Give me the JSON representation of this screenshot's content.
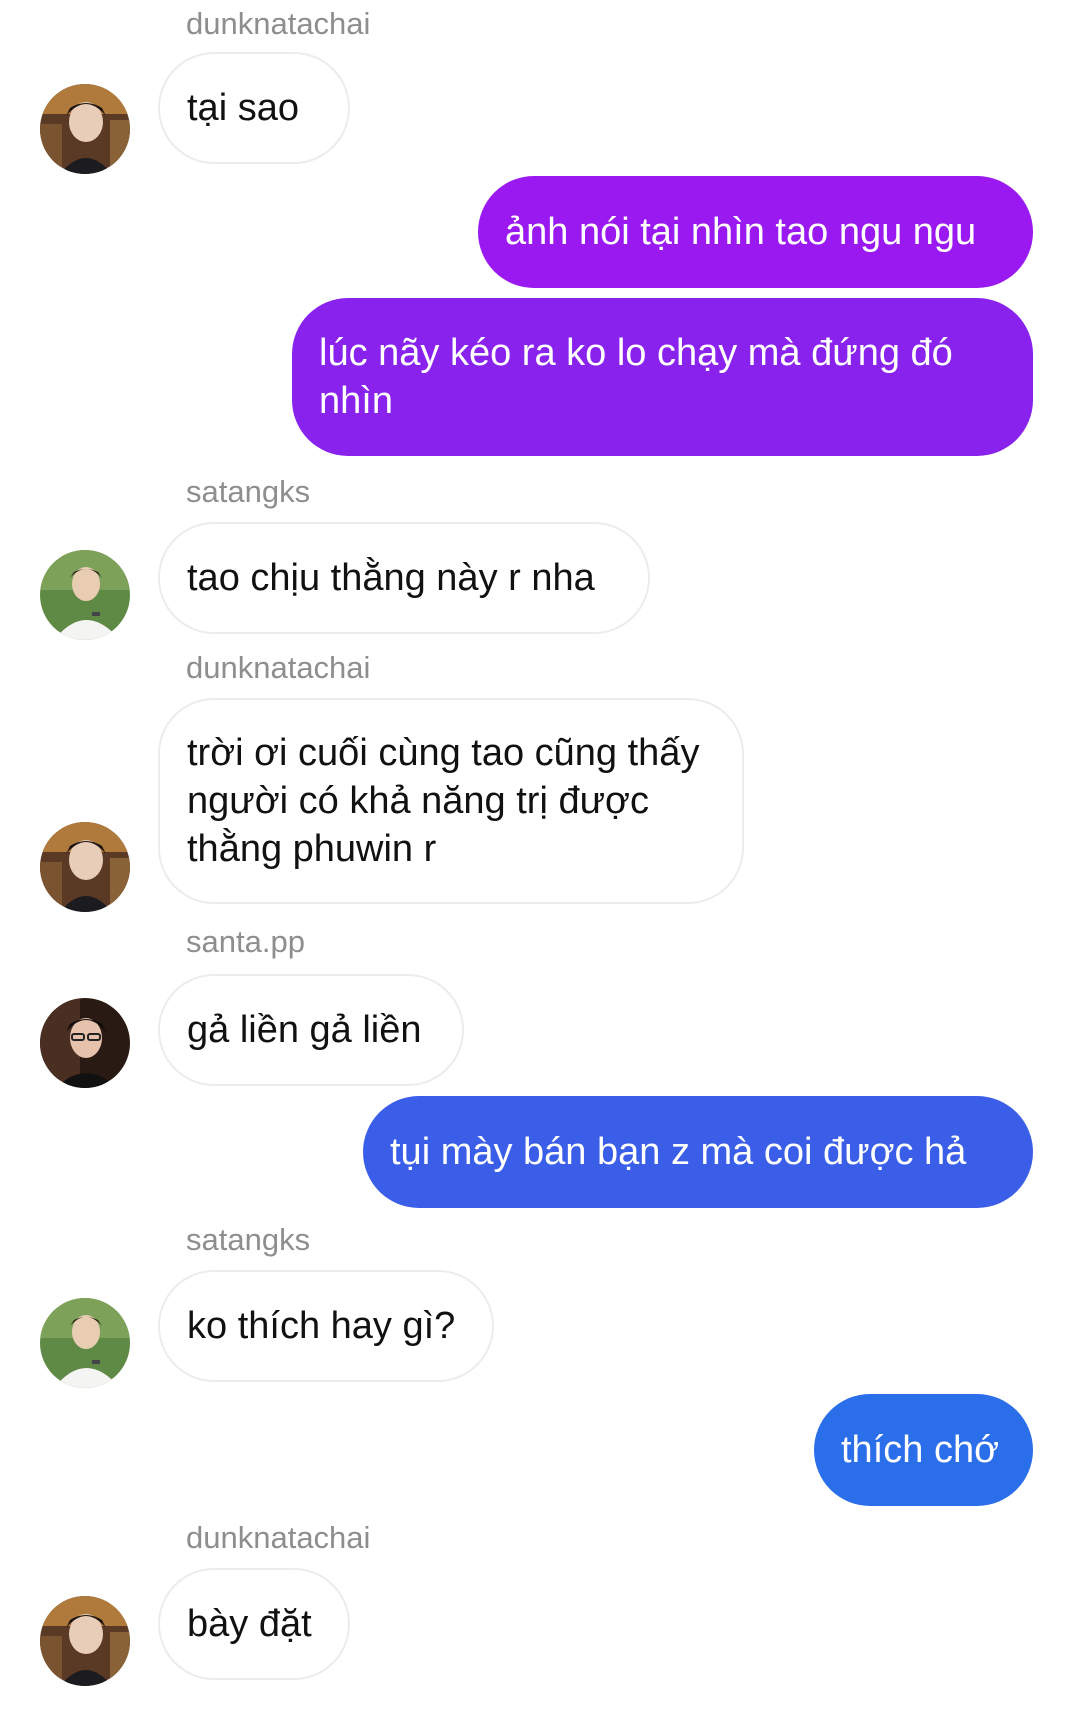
{
  "messages": [
    {
      "id": "m1",
      "direction": "in",
      "sender": "dunknatachai",
      "text": "tại sao",
      "avatar": "dunk-avatar"
    },
    {
      "id": "m2",
      "direction": "out",
      "text": "ảnh nói tại nhìn tao ngu ngu",
      "color": "#9a19f0"
    },
    {
      "id": "m3",
      "direction": "out",
      "text": "lúc nãy kéo ra ko lo chạy mà đứng đó nhìn",
      "color": "#8a22ee"
    },
    {
      "id": "m4",
      "direction": "in",
      "sender": "satangks",
      "text": "tao chịu thằng này r nha",
      "avatar": "satang-avatar"
    },
    {
      "id": "m5",
      "direction": "in",
      "sender": "dunknatachai",
      "text": "trời ơi cuối cùng tao cũng thấy người có khả năng trị được thằng phuwin r",
      "avatar": "dunk-avatar"
    },
    {
      "id": "m6",
      "direction": "in",
      "sender": "santa.pp",
      "text": "gả liền gả liền",
      "avatar": "santa-avatar"
    },
    {
      "id": "m7",
      "direction": "out",
      "text": "tụi mày bán bạn z mà coi được hả",
      "color": "#3b5ee8"
    },
    {
      "id": "m8",
      "direction": "in",
      "sender": "satangks",
      "text": "ko thích hay gì?",
      "avatar": "satang-avatar"
    },
    {
      "id": "m9",
      "direction": "out",
      "text": "thích chớ",
      "color": "#2b6ee9"
    },
    {
      "id": "m10",
      "direction": "in",
      "sender": "dunknatachai",
      "text": "bày đặt",
      "avatar": "dunk-avatar"
    }
  ]
}
